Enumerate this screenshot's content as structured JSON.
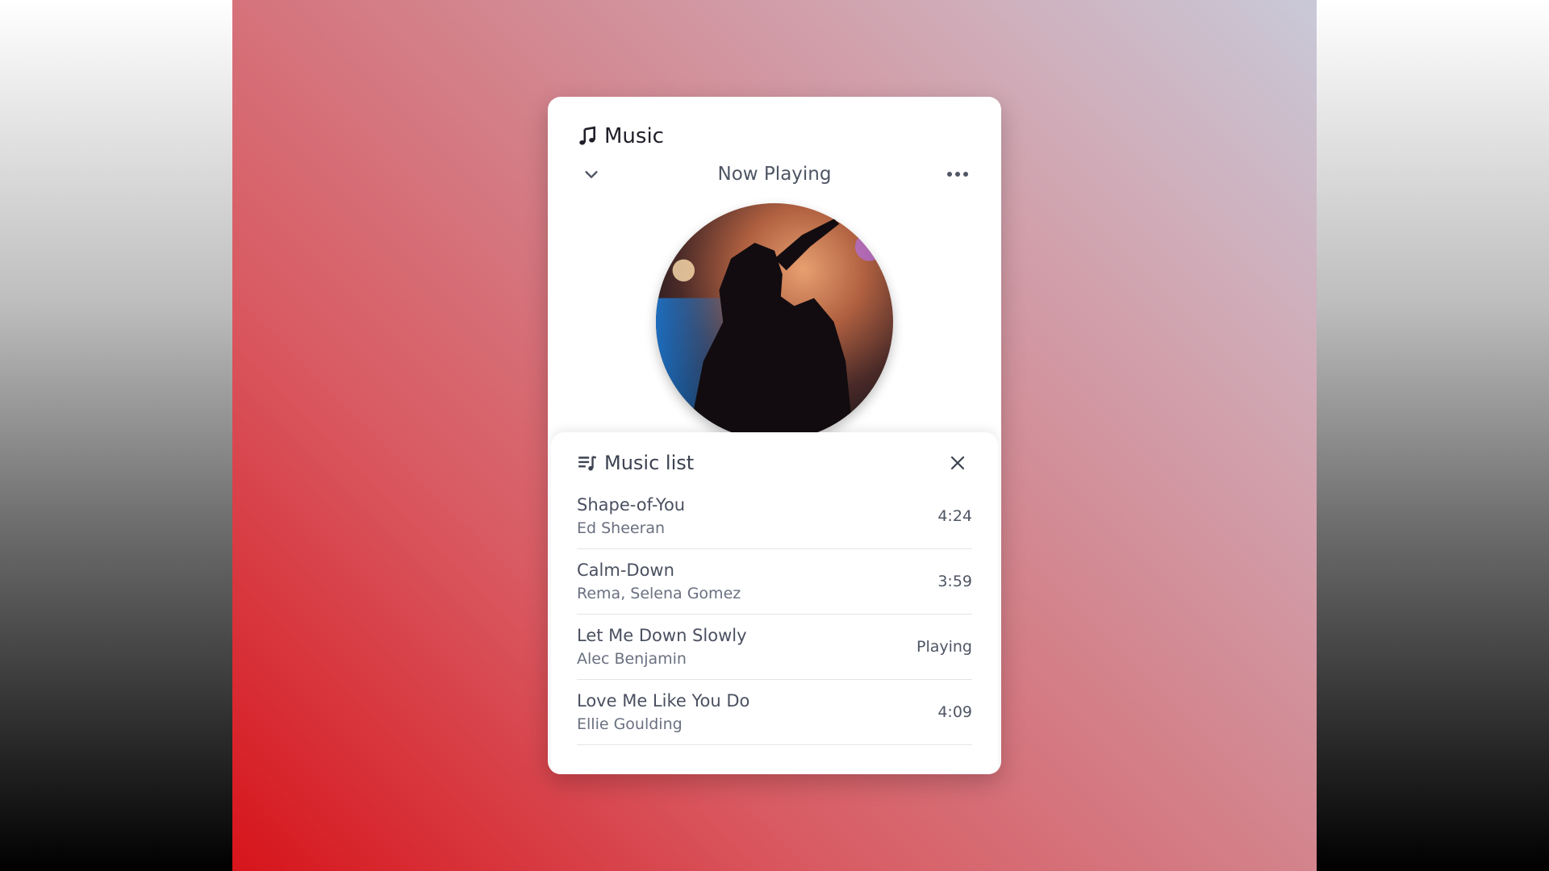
{
  "app": {
    "title": "Music"
  },
  "player": {
    "now_playing_label": "Now Playing"
  },
  "playlist": {
    "title": "Music list",
    "tracks": [
      {
        "title": "Shape-of-You",
        "artist": "Ed Sheeran",
        "duration": "4:24"
      },
      {
        "title": "Calm-Down",
        "artist": "Rema, Selena Gomez",
        "duration": "3:59"
      },
      {
        "title": "Let Me Down Slowly",
        "artist": "Alec Benjamin",
        "duration": "Playing"
      },
      {
        "title": "Love Me Like You Do",
        "artist": "Ellie Goulding",
        "duration": "4:09"
      }
    ]
  },
  "icons": {
    "app": "music-note-icon",
    "collapse": "chevron-down-icon",
    "more": "more-horizontal-icon",
    "playlist": "playlist-icon",
    "close": "close-icon"
  },
  "colors": {
    "text_dark": "#1f1f2a",
    "text_muted": "#4e5564",
    "card_bg": "#ffffff",
    "gradient_red": "#d7141b"
  }
}
